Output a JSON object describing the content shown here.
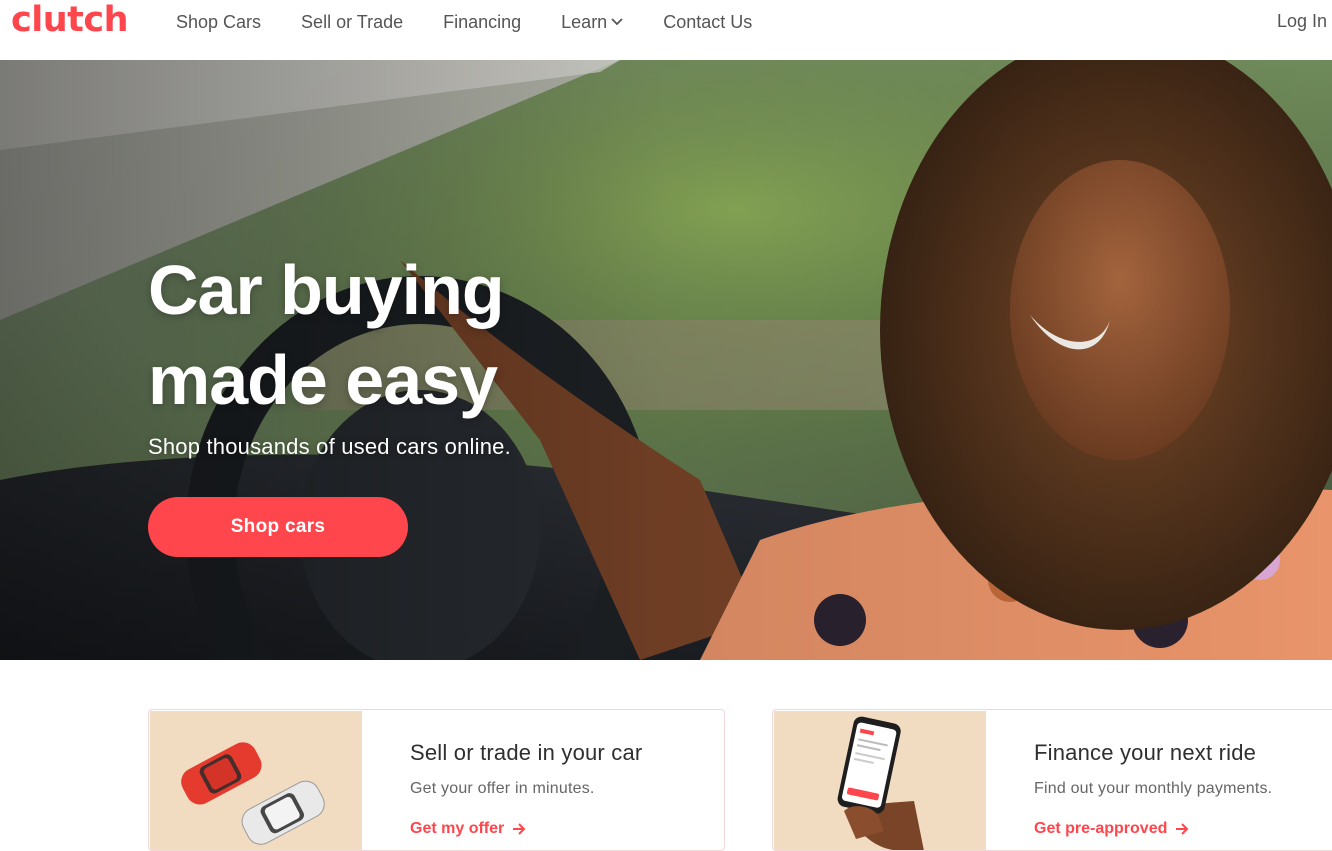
{
  "brand": {
    "logo_text": "clutch",
    "accent_color": "#ff464c"
  },
  "nav": {
    "items": [
      {
        "label": "Shop Cars"
      },
      {
        "label": "Sell or Trade"
      },
      {
        "label": "Financing"
      },
      {
        "label": "Learn",
        "icon": "chevron-down-icon"
      },
      {
        "label": "Contact Us"
      }
    ],
    "login_label": "Log In"
  },
  "hero": {
    "title_line1": "Car buying",
    "title_line2": "made easy",
    "subtitle": "Shop thousands of used cars online.",
    "cta_label": "Shop cars"
  },
  "cards": [
    {
      "title": "Sell or trade in your car",
      "description": "Get your offer in minutes.",
      "link_label": "Get my offer",
      "image_icon": "cars-top-view-icon"
    },
    {
      "title": "Finance your next ride",
      "description": "Find out your monthly payments.",
      "link_label": "Get pre-approved",
      "image_icon": "phone-in-hand-icon"
    }
  ]
}
